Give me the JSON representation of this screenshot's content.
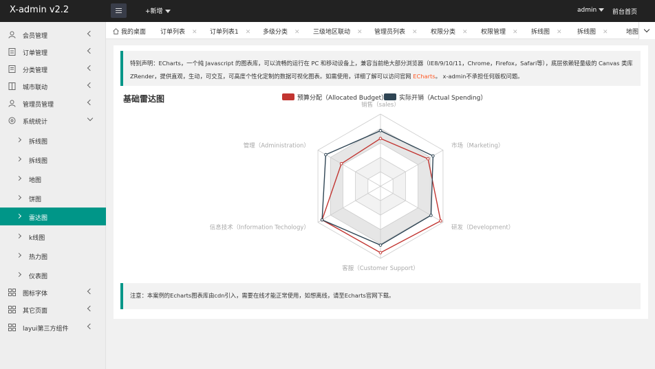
{
  "app": {
    "title": "X-admin v2.2",
    "add_new": "+新增",
    "user": "admin",
    "front_link": "前台首页"
  },
  "sidebar": {
    "items": [
      {
        "label": "会员管理",
        "icon": "user-icon"
      },
      {
        "label": "订单管理",
        "icon": "order-icon"
      },
      {
        "label": "分类管理",
        "icon": "category-icon"
      },
      {
        "label": "城市联动",
        "icon": "city-icon"
      },
      {
        "label": "管理员管理",
        "icon": "admin-icon"
      },
      {
        "label": "系统统计",
        "icon": "stats-icon"
      }
    ],
    "sub_items": [
      {
        "label": "拆线图"
      },
      {
        "label": "拆线图"
      },
      {
        "label": "地图"
      },
      {
        "label": "饼图"
      },
      {
        "label": "雷达图",
        "active": true
      },
      {
        "label": "k线图"
      },
      {
        "label": "热力图"
      },
      {
        "label": "仪表图"
      }
    ],
    "bottom_items": [
      {
        "label": "图标字体",
        "icon": "grid-icon"
      },
      {
        "label": "其它页面",
        "icon": "grid-icon"
      },
      {
        "label": "layui第三方组件",
        "icon": "grid-icon"
      }
    ]
  },
  "tabs": [
    {
      "label": "我的桌面"
    },
    {
      "label": "订单列表"
    },
    {
      "label": "订单列表1"
    },
    {
      "label": "多级分类"
    },
    {
      "label": "三级地区联动"
    },
    {
      "label": "管理员列表"
    },
    {
      "label": "权限分类"
    },
    {
      "label": "权限管理"
    },
    {
      "label": "拆线图"
    },
    {
      "label": "拆线图"
    },
    {
      "label": "地图"
    }
  ],
  "notice": {
    "text": "特别声明：ECharts，一个纯 Javascript 的图表库，可以流畅的运行在 PC 和移动设备上，兼容当前绝大部分浏览器（IE8/9/10/11，Chrome，Firefox，Safari等），底层依赖轻量级的 Canvas 类库 ZRender，提供直观，生动，可交互，可高度个性化定制的数据可视化图表。如需使用，详细了解可以访问官网",
    "link": "ECharts",
    "suffix": "。 x-admin不承担任何版权问题。"
  },
  "footer_notice": "注意：本案例的Echarts图表库由cdn引入，需要在线才能正常使用，如想离线，请至Echarts官网下载。",
  "colors": {
    "accent": "#009688",
    "budget": "#c23531",
    "actual": "#2f4554"
  },
  "chart_data": {
    "type": "radar",
    "title": "基础雷达图",
    "legend": [
      "预算分配（Allocated Budget）",
      "实际开销（Actual Spending）"
    ],
    "indicators": [
      {
        "name": "销售（sales）",
        "max": 6500
      },
      {
        "name": "管理（Administration）",
        "max": 16000
      },
      {
        "name": "信息技术（Information Techology）",
        "max": 30000
      },
      {
        "name": "客服（Customer Support）",
        "max": 38000
      },
      {
        "name": "研发（Development）",
        "max": 52000
      },
      {
        "name": "市场（Marketing）",
        "max": 25000
      }
    ],
    "series": [
      {
        "name": "预算分配（Allocated Budget）",
        "values": [
          4300,
          10000,
          28000,
          35000,
          50000,
          19000
        ]
      },
      {
        "name": "实际开销（Actual Spending）",
        "values": [
          5000,
          14000,
          28000,
          31000,
          42000,
          21000
        ]
      }
    ]
  }
}
